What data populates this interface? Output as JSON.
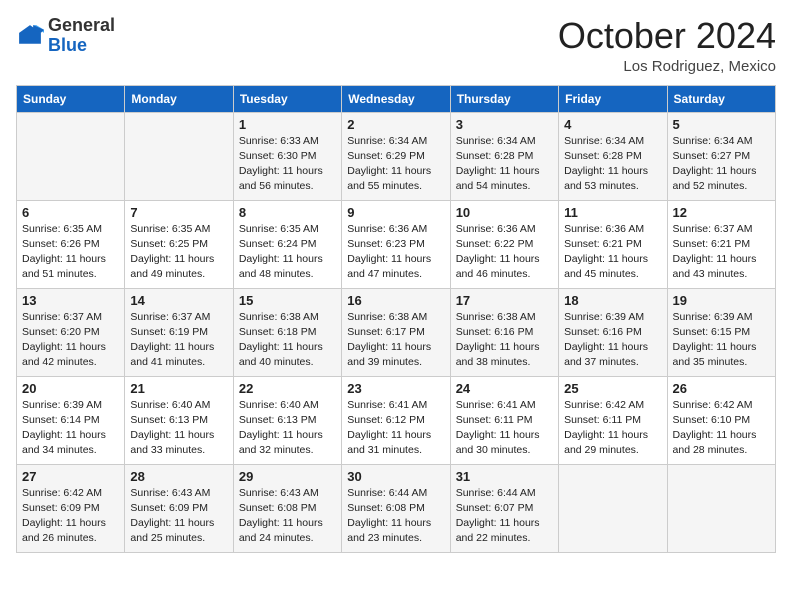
{
  "header": {
    "logo_general": "General",
    "logo_blue": "Blue",
    "month_title": "October 2024",
    "location": "Los Rodriguez, Mexico"
  },
  "days_of_week": [
    "Sunday",
    "Monday",
    "Tuesday",
    "Wednesday",
    "Thursday",
    "Friday",
    "Saturday"
  ],
  "weeks": [
    [
      {
        "day": "",
        "info": ""
      },
      {
        "day": "",
        "info": ""
      },
      {
        "day": "1",
        "info": "Sunrise: 6:33 AM\nSunset: 6:30 PM\nDaylight: 11 hours and 56 minutes."
      },
      {
        "day": "2",
        "info": "Sunrise: 6:34 AM\nSunset: 6:29 PM\nDaylight: 11 hours and 55 minutes."
      },
      {
        "day": "3",
        "info": "Sunrise: 6:34 AM\nSunset: 6:28 PM\nDaylight: 11 hours and 54 minutes."
      },
      {
        "day": "4",
        "info": "Sunrise: 6:34 AM\nSunset: 6:28 PM\nDaylight: 11 hours and 53 minutes."
      },
      {
        "day": "5",
        "info": "Sunrise: 6:34 AM\nSunset: 6:27 PM\nDaylight: 11 hours and 52 minutes."
      }
    ],
    [
      {
        "day": "6",
        "info": "Sunrise: 6:35 AM\nSunset: 6:26 PM\nDaylight: 11 hours and 51 minutes."
      },
      {
        "day": "7",
        "info": "Sunrise: 6:35 AM\nSunset: 6:25 PM\nDaylight: 11 hours and 49 minutes."
      },
      {
        "day": "8",
        "info": "Sunrise: 6:35 AM\nSunset: 6:24 PM\nDaylight: 11 hours and 48 minutes."
      },
      {
        "day": "9",
        "info": "Sunrise: 6:36 AM\nSunset: 6:23 PM\nDaylight: 11 hours and 47 minutes."
      },
      {
        "day": "10",
        "info": "Sunrise: 6:36 AM\nSunset: 6:22 PM\nDaylight: 11 hours and 46 minutes."
      },
      {
        "day": "11",
        "info": "Sunrise: 6:36 AM\nSunset: 6:21 PM\nDaylight: 11 hours and 45 minutes."
      },
      {
        "day": "12",
        "info": "Sunrise: 6:37 AM\nSunset: 6:21 PM\nDaylight: 11 hours and 43 minutes."
      }
    ],
    [
      {
        "day": "13",
        "info": "Sunrise: 6:37 AM\nSunset: 6:20 PM\nDaylight: 11 hours and 42 minutes."
      },
      {
        "day": "14",
        "info": "Sunrise: 6:37 AM\nSunset: 6:19 PM\nDaylight: 11 hours and 41 minutes."
      },
      {
        "day": "15",
        "info": "Sunrise: 6:38 AM\nSunset: 6:18 PM\nDaylight: 11 hours and 40 minutes."
      },
      {
        "day": "16",
        "info": "Sunrise: 6:38 AM\nSunset: 6:17 PM\nDaylight: 11 hours and 39 minutes."
      },
      {
        "day": "17",
        "info": "Sunrise: 6:38 AM\nSunset: 6:16 PM\nDaylight: 11 hours and 38 minutes."
      },
      {
        "day": "18",
        "info": "Sunrise: 6:39 AM\nSunset: 6:16 PM\nDaylight: 11 hours and 37 minutes."
      },
      {
        "day": "19",
        "info": "Sunrise: 6:39 AM\nSunset: 6:15 PM\nDaylight: 11 hours and 35 minutes."
      }
    ],
    [
      {
        "day": "20",
        "info": "Sunrise: 6:39 AM\nSunset: 6:14 PM\nDaylight: 11 hours and 34 minutes."
      },
      {
        "day": "21",
        "info": "Sunrise: 6:40 AM\nSunset: 6:13 PM\nDaylight: 11 hours and 33 minutes."
      },
      {
        "day": "22",
        "info": "Sunrise: 6:40 AM\nSunset: 6:13 PM\nDaylight: 11 hours and 32 minutes."
      },
      {
        "day": "23",
        "info": "Sunrise: 6:41 AM\nSunset: 6:12 PM\nDaylight: 11 hours and 31 minutes."
      },
      {
        "day": "24",
        "info": "Sunrise: 6:41 AM\nSunset: 6:11 PM\nDaylight: 11 hours and 30 minutes."
      },
      {
        "day": "25",
        "info": "Sunrise: 6:42 AM\nSunset: 6:11 PM\nDaylight: 11 hours and 29 minutes."
      },
      {
        "day": "26",
        "info": "Sunrise: 6:42 AM\nSunset: 6:10 PM\nDaylight: 11 hours and 28 minutes."
      }
    ],
    [
      {
        "day": "27",
        "info": "Sunrise: 6:42 AM\nSunset: 6:09 PM\nDaylight: 11 hours and 26 minutes."
      },
      {
        "day": "28",
        "info": "Sunrise: 6:43 AM\nSunset: 6:09 PM\nDaylight: 11 hours and 25 minutes."
      },
      {
        "day": "29",
        "info": "Sunrise: 6:43 AM\nSunset: 6:08 PM\nDaylight: 11 hours and 24 minutes."
      },
      {
        "day": "30",
        "info": "Sunrise: 6:44 AM\nSunset: 6:08 PM\nDaylight: 11 hours and 23 minutes."
      },
      {
        "day": "31",
        "info": "Sunrise: 6:44 AM\nSunset: 6:07 PM\nDaylight: 11 hours and 22 minutes."
      },
      {
        "day": "",
        "info": ""
      },
      {
        "day": "",
        "info": ""
      }
    ]
  ]
}
